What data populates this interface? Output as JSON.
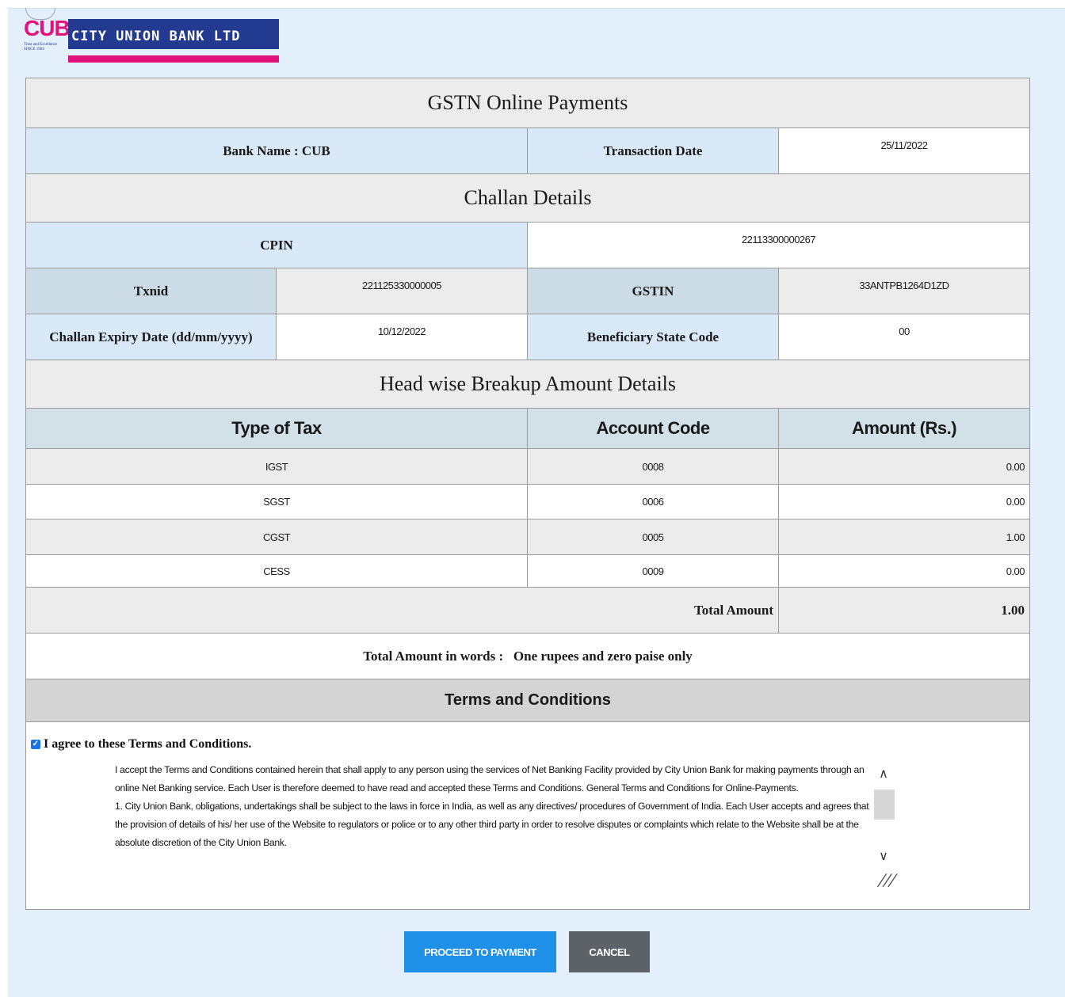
{
  "logo": {
    "short": "CUB",
    "name": "CITY UNION BANK LTD",
    "tagline": "Trust and Excellence",
    "since": "SINCE 1904"
  },
  "title": "GSTN Online Payments",
  "bank": {
    "label": "Bank Name : CUB",
    "txn_date_label": "Transaction Date",
    "txn_date": "25/11/2022"
  },
  "challan": {
    "heading": "Challan Details",
    "cpin_label": "CPIN",
    "cpin": "22113300000267",
    "txnid_label": "Txnid",
    "txnid": "221125330000005",
    "gstin_label": "GSTIN",
    "gstin": "33ANTPB1264D1ZD",
    "expiry_label": "Challan Expiry Date (dd/mm/yyyy)",
    "expiry": "10/12/2022",
    "state_label": "Beneficiary State Code",
    "state": "00"
  },
  "breakup": {
    "heading": "Head wise Breakup Amount Details",
    "columns": [
      "Type of Tax",
      "Account Code",
      "Amount (Rs.)"
    ],
    "rows": [
      {
        "tax": "IGST",
        "code": "0008",
        "amount": "0.00"
      },
      {
        "tax": "SGST",
        "code": "0006",
        "amount": "0.00"
      },
      {
        "tax": "CGST",
        "code": "0005",
        "amount": "1.00"
      },
      {
        "tax": "CESS",
        "code": "0009",
        "amount": "0.00"
      }
    ],
    "total_label": "Total Amount",
    "total": "1.00",
    "words_label": "Total Amount in words :",
    "words": "One rupees and zero paise only"
  },
  "terms": {
    "heading": "Terms and Conditions",
    "agree_label": "I agree to these Terms and Conditions.",
    "agree_checked": true,
    "para1": "I accept the Terms and Conditions contained herein that shall apply to any person using the services of Net Banking Facility provided by City Union Bank for making payments through an online Net Banking service. Each User is therefore deemed to have read and accepted these Terms and Conditions. General Terms and Conditions for Online-Payments.",
    "para2": "1. City Union Bank, obligations, undertakings shall be subject to the laws in force in India, as well as any directives/ procedures of Government of India. Each User accepts and agrees that the provision of details of his/ her use of the Website to regulators or police or to any other third party in order to resolve disputes or complaints which relate to the Website shall be at the absolute discretion of the City Union Bank."
  },
  "buttons": {
    "proceed": "PROCEED TO PAYMENT",
    "cancel": "CANCEL"
  }
}
